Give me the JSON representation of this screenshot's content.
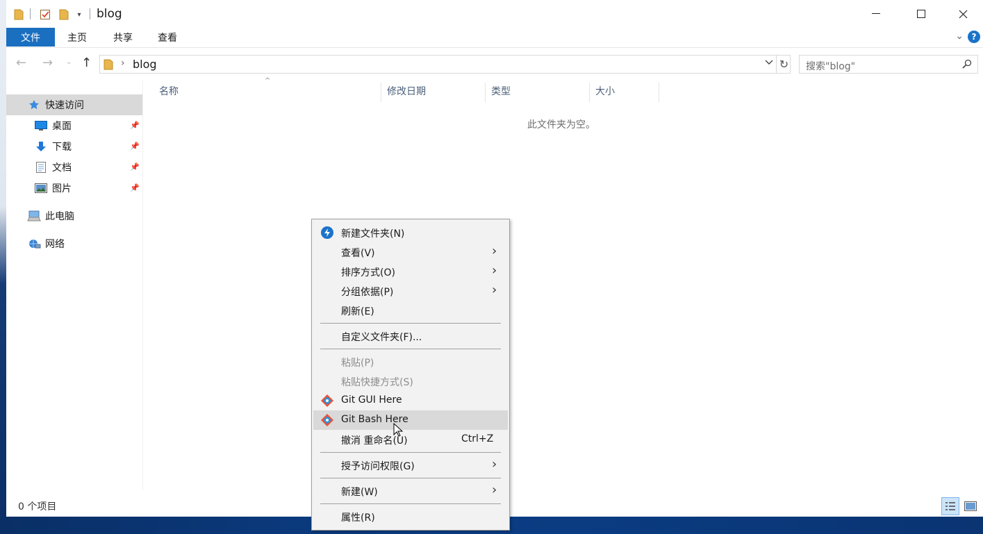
{
  "window": {
    "title": "blog",
    "controls": {
      "minimize": "—",
      "maximize": "☐",
      "close": "✕"
    }
  },
  "ribbon": {
    "tabs": [
      "文件",
      "主页",
      "共享",
      "查看"
    ],
    "help": "?"
  },
  "address": {
    "path": "blog",
    "search_placeholder": "搜索\"blog\""
  },
  "nav_pane": {
    "quick_access": "快速访问",
    "items": [
      {
        "label": "桌面",
        "icon": "desktop-icon",
        "pinned": true
      },
      {
        "label": "下载",
        "icon": "download-icon",
        "pinned": true
      },
      {
        "label": "文档",
        "icon": "document-icon",
        "pinned": true
      },
      {
        "label": "图片",
        "icon": "picture-icon",
        "pinned": true
      }
    ],
    "this_pc": "此电脑",
    "network": "网络"
  },
  "columns": [
    "名称",
    "修改日期",
    "类型",
    "大小"
  ],
  "empty_message": "此文件夹为空。",
  "status": {
    "item_count": "0 个项目"
  },
  "context_menu": {
    "items": [
      {
        "label": "新建文件夹(N)",
        "icon": "new-folder-icon"
      },
      {
        "label": "查看(V)",
        "submenu": true
      },
      {
        "label": "排序方式(O)",
        "submenu": true
      },
      {
        "label": "分组依据(P)",
        "submenu": true
      },
      {
        "label": "刷新(E)"
      },
      {
        "label": "自定义文件夹(F)..."
      },
      {
        "label": "粘贴(P)",
        "disabled": true
      },
      {
        "label": "粘贴快捷方式(S)",
        "disabled": true
      },
      {
        "label": "Git GUI Here",
        "icon": "git-icon"
      },
      {
        "label": "Git Bash Here",
        "icon": "git-icon",
        "highlighted": true
      },
      {
        "label": "撤消 重命名(U)",
        "shortcut": "Ctrl+Z"
      },
      {
        "label": "授予访问权限(G)",
        "submenu": true
      },
      {
        "label": "新建(W)",
        "submenu": true
      },
      {
        "label": "属性(R)"
      }
    ]
  },
  "colors": {
    "accent": "#1a6fc0",
    "selection": "#d9d9d9",
    "git": "#f05133"
  }
}
